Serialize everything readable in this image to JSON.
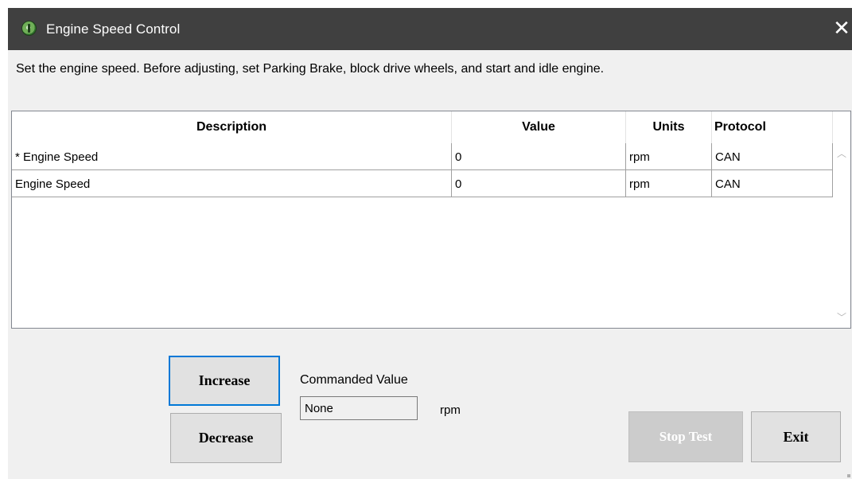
{
  "window": {
    "title": "Engine Speed Control",
    "icon": "green-power-icon",
    "close_glyph": "✕"
  },
  "instructions": "Set the engine speed. Before adjusting, set Parking Brake, block drive wheels, and start and idle engine.",
  "table": {
    "columns": [
      "Description",
      "Value",
      "Units",
      "Protocol"
    ],
    "rows": [
      {
        "description": "* Engine Speed",
        "value": "0",
        "units": "rpm",
        "protocol": "CAN"
      },
      {
        "description": "Engine Speed",
        "value": "0",
        "units": "rpm",
        "protocol": "CAN"
      }
    ],
    "scroll_up_glyph": "︿",
    "scroll_down_glyph": "﹀"
  },
  "controls": {
    "increase_label": "Increase",
    "decrease_label": "Decrease",
    "commanded_value_label": "Commanded Value",
    "commanded_value": "None",
    "commanded_unit": "rpm",
    "stop_test_label": "Stop Test",
    "exit_label": "Exit"
  },
  "colors": {
    "titlebar": "#404040",
    "dialog_background": "#f0f0f0",
    "focus_border": "#0078d7",
    "disabled_button": "#cccccc"
  }
}
